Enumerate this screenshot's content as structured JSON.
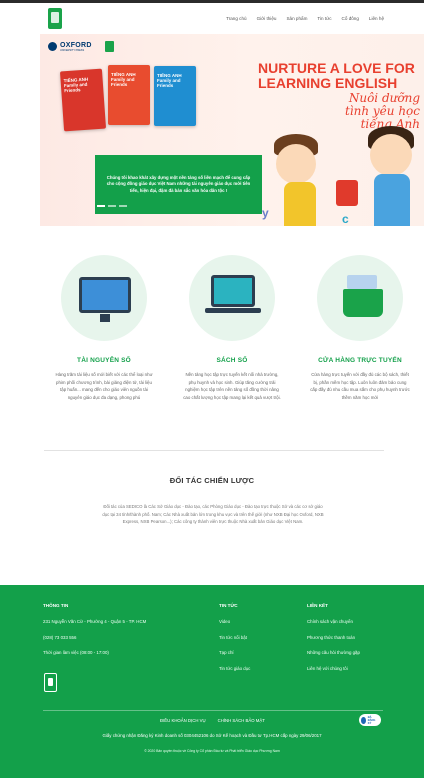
{
  "nav": {
    "items": [
      "Trang chủ",
      "Giới thiệu",
      "Sản phẩm",
      "Tin tức",
      "Cổ đông",
      "Liên hệ"
    ]
  },
  "hero": {
    "oxford_logo": "OXFORD",
    "oxford_sub": "UNIVERSITY PRESS",
    "headline": "NURTURE A LOVE FOR LEARNING ENGLISH",
    "subheadline": "Nuôi dưỡng tình yêu học tiếng Anh",
    "book_title": "TIẾNG ANH Family and Friends",
    "mission_text": "Chúng tôi khao khát xây dựng một nền tảng số liên mạch để cung cấp cho cộng đồng giáo dục Việt Nam những tài nguyên giáo dục mới tiên tiến, hiện đại, đậm đà bản sắc văn hóa dân tộc !",
    "slides": 3,
    "active_slide": 0
  },
  "features": [
    {
      "icon": "monitor-icon",
      "title": "TÀI NGUYÊN SỐ",
      "text": "Hàng trăm tài liệu số mới biết với các thể loại như phim phối chương trình, bài giảng điện tử, tài liệu tập huấn... mang đến cho giáo viên nguồn tài nguyên giáo dục đa dạng, phong phú"
    },
    {
      "icon": "laptop-icon",
      "title": "SÁCH SỐ",
      "text": "Nền tảng học tập trực tuyến kết nối nhà trường, phụ huynh và học sinh. Giúp tăng cường trải nghiệm học tập trên nền tảng số đồng thời nâng cao chất lượng học tập mang lại kết quả vượt trội."
    },
    {
      "icon": "cart-icon",
      "title": "CỬA HÀNG TRỰC TUYẾN",
      "text": "Cửa hàng trực tuyến với đầy đủ các bộ sách, thiết bị, phần mềm học tập. Luôn luôn đảm bảo cung cấp đầy đủ nhu cầu mua sắm cho phụ huynh trước thềm năm học mới"
    }
  ],
  "partners": {
    "title": "ĐỐI TÁC CHIẾN LƯỢC",
    "text": "Đối tác của SEDICO là Các Sở Giáo dục - Đào tạo, các Phòng Giáo dục - Đào tạo trực thuộc Sở và các cơ sở giáo dục tại 34 tỉnh/thành phố. Nam; Các Nhà xuất bản lớn trong khu vực và trên thế giới (như NXB Đại học Oxford, NXB Express, NXB Pearson...); Các công ty thành viên trực thuộc Nhà xuất bản Giáo dục Việt Nam."
  },
  "footer": {
    "contact": {
      "heading": "THÔNG TIN",
      "address": "231 Nguyễn Văn Cừ - Phường 4 - Quận 5 - TP. HCM",
      "phone": "(028) 73 033 556",
      "hours": "Thời gian làm việc (08:00 - 17:00)"
    },
    "news": {
      "heading": "TIN TỨC",
      "items": [
        "Video",
        "Tin tức nổi bật",
        "Tạp chí",
        "Tin tức giáo dục"
      ]
    },
    "links": {
      "heading": "LIÊN KẾT",
      "items": [
        "Chính sách vận chuyển",
        "Phương thức thanh toán",
        "Những câu hỏi thường gặp",
        "Liên hệ với chúng tôi"
      ]
    },
    "bottom_links": [
      "ĐIỀU KHOẢN DỊCH VỤ",
      "CHÍNH SÁCH BẢO MẬT"
    ],
    "certificate": "ĐÃ ĐĂNG KÝ",
    "license": "Giấy chứng nhận Đăng ký Kinh doanh số 0304452106 do Sở Kế hoạch và Đầu tư Tp.HCM cấp ngày 29/06/2017",
    "copyright": "© 2020 Bản quyền thuộc về Công ty Cổ phần Đầu tư và Phát triển Giáo dục Phương Nam"
  }
}
